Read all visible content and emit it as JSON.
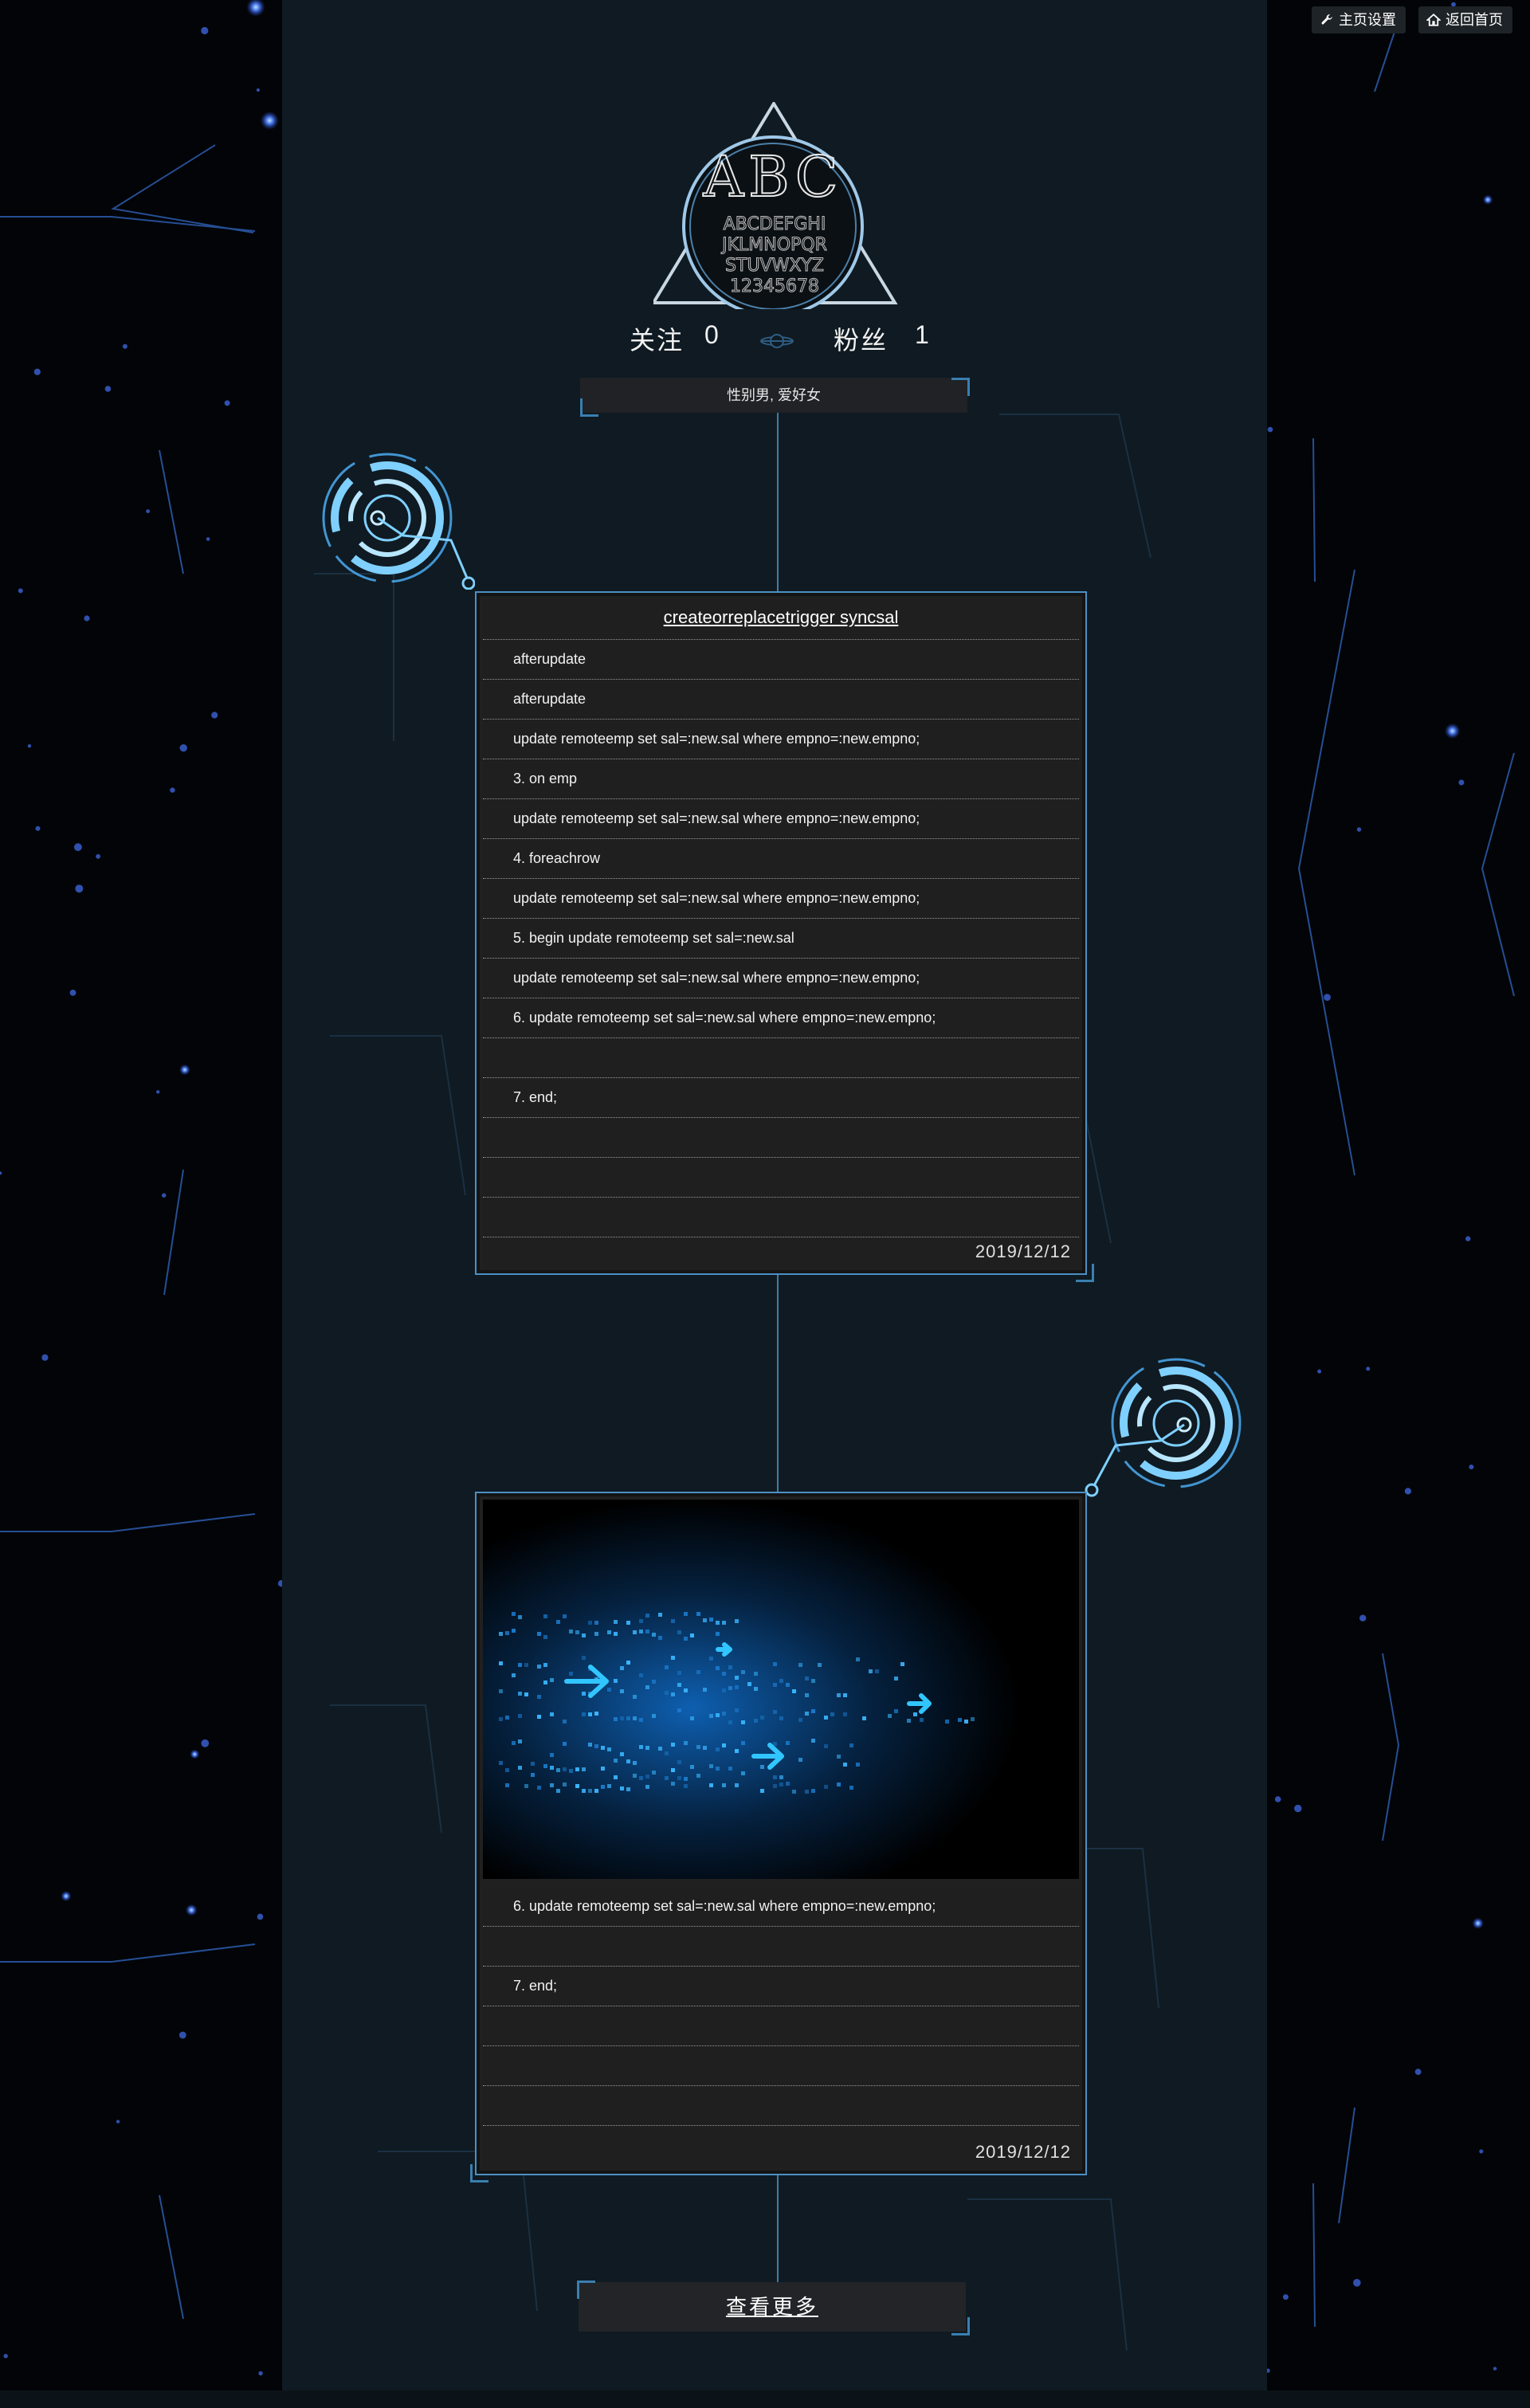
{
  "toolbar": {
    "settings_label": "主页设置",
    "home_label": "返回首页"
  },
  "profile": {
    "avatar_letters": "ABC",
    "avatar_alphabet": [
      "ABCDEFGHI",
      "JKLMNOPQR",
      "STUVWXYZ",
      "12345678"
    ],
    "following_label": "关注",
    "following_count": "0",
    "followers_label": "粉丝",
    "followers_count": "1",
    "bio": "性别男, 爱好女"
  },
  "posts": [
    {
      "title": "createorreplacetrigger syncsal",
      "lines": [
        "afterupdate",
        "afterupdate",
        "update remoteemp set sal=:new.sal where empno=:new.empno;",
        "3. on emp",
        "update remoteemp set sal=:new.sal where empno=:new.empno;",
        "4. foreachrow",
        "update remoteemp set sal=:new.sal where empno=:new.empno;",
        "5. begin update remoteemp set sal=:new.sal",
        "update remoteemp set sal=:new.sal where empno=:new.empno;",
        "6. update remoteemp set sal=:new.sal where empno=:new.empno;",
        "",
        "7. end;",
        "",
        "",
        ""
      ],
      "date": "2019/12/12"
    },
    {
      "lines": [
        "6. update remoteemp set sal=:new.sal where empno=:new.empno;",
        "",
        "7. end;",
        "",
        "",
        ""
      ],
      "date": "2019/12/12"
    }
  ],
  "more_label": "查看更多",
  "colors": {
    "accent": "#4b90c4",
    "panel": "#202020",
    "strip": "#0f1a22"
  }
}
